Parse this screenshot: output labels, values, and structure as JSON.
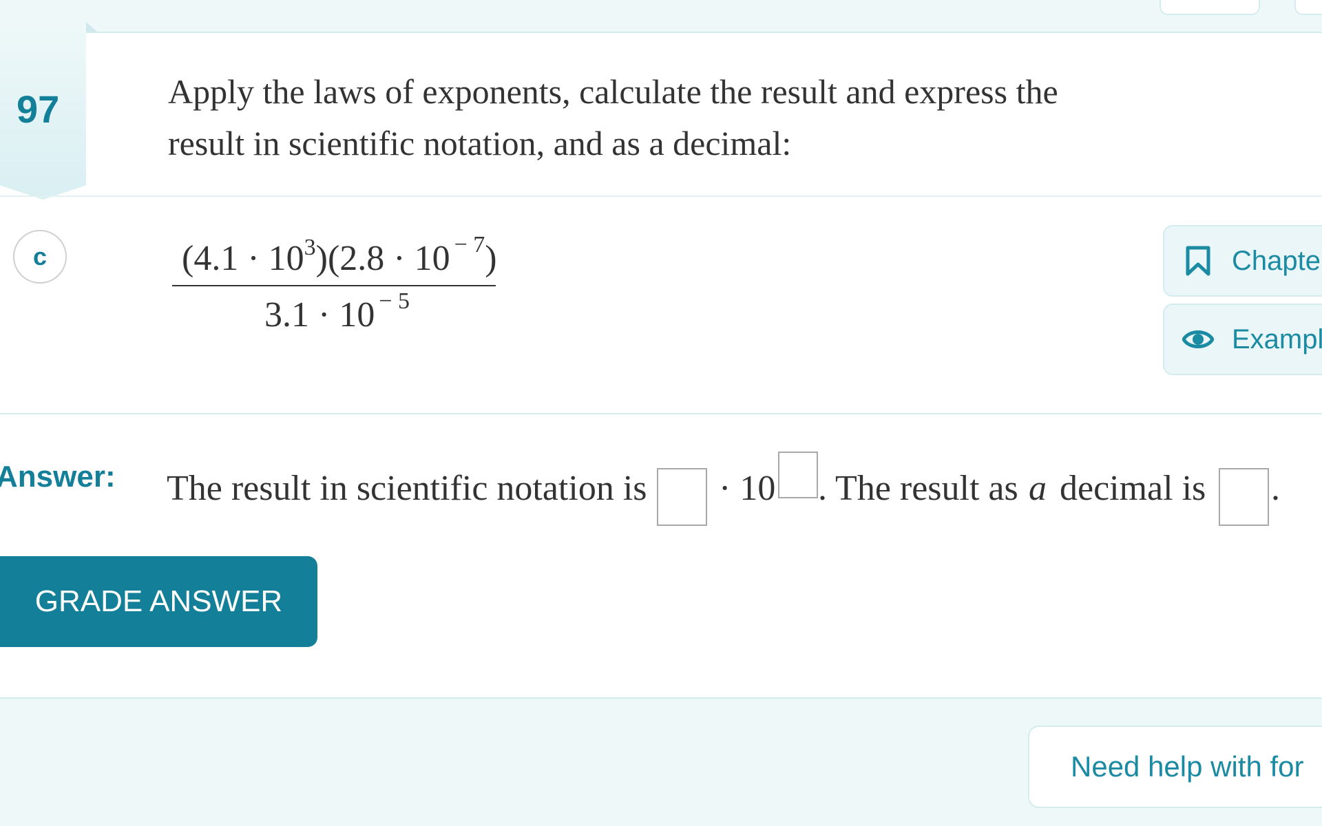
{
  "problem": {
    "number": "97",
    "prompt_line1": "Apply the laws of exponents, calculate the result and express the",
    "prompt_line2": "result in scientific notation, and as a decimal:"
  },
  "part": {
    "label": "c",
    "expression": {
      "numerator": {
        "open1": "(4.1 · 10",
        "exp1": "3",
        "mid": ")(2.8 · 10",
        "exp2": "− 7",
        "close": ")"
      },
      "denominator": {
        "base": "3.1 · 10",
        "exp": "− 5"
      }
    }
  },
  "side_buttons": {
    "chapter_label": "Chapter",
    "example_label": "Example"
  },
  "answer": {
    "label": "Answer:",
    "text_before": "The result in scientific notation is",
    "times_ten": "· 10",
    "text_middle": ". The result as",
    "italic_a": "a",
    "text_decimal": "decimal is",
    "period": "."
  },
  "grade_button_label": "GRADE ANSWER",
  "help_button_label": "Need help with for"
}
